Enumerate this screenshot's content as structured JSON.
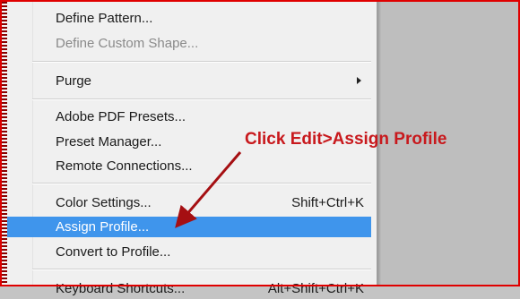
{
  "menu": {
    "items": [
      {
        "label": "Define Pattern...",
        "shortcut": "",
        "disabled": false
      },
      {
        "label": "Define Custom Shape...",
        "shortcut": "",
        "disabled": true
      },
      {
        "label": "Purge",
        "shortcut": "",
        "disabled": false,
        "submenu": true
      },
      {
        "label": "Adobe PDF Presets...",
        "shortcut": "",
        "disabled": false
      },
      {
        "label": "Preset Manager...",
        "shortcut": "",
        "disabled": false
      },
      {
        "label": "Remote Connections...",
        "shortcut": "",
        "disabled": false
      },
      {
        "label": "Color Settings...",
        "shortcut": "Shift+Ctrl+K",
        "disabled": false
      },
      {
        "label": "Assign Profile...",
        "shortcut": "",
        "disabled": false,
        "highlighted": true
      },
      {
        "label": "Convert to Profile...",
        "shortcut": "",
        "disabled": false
      },
      {
        "label": "Keyboard Shortcuts...",
        "shortcut": "Alt+Shift+Ctrl+K",
        "disabled": false
      }
    ]
  },
  "annotation": {
    "text": "Click Edit>Assign Profile",
    "color": "#c8191d"
  },
  "colors": {
    "highlight": "#3f95ec",
    "frame_border": "#e00000",
    "menu_background": "#f0f0f0",
    "panel_background": "#bebebe"
  },
  "icons": [
    "submenu-arrow-icon",
    "pointer-arrow"
  ]
}
